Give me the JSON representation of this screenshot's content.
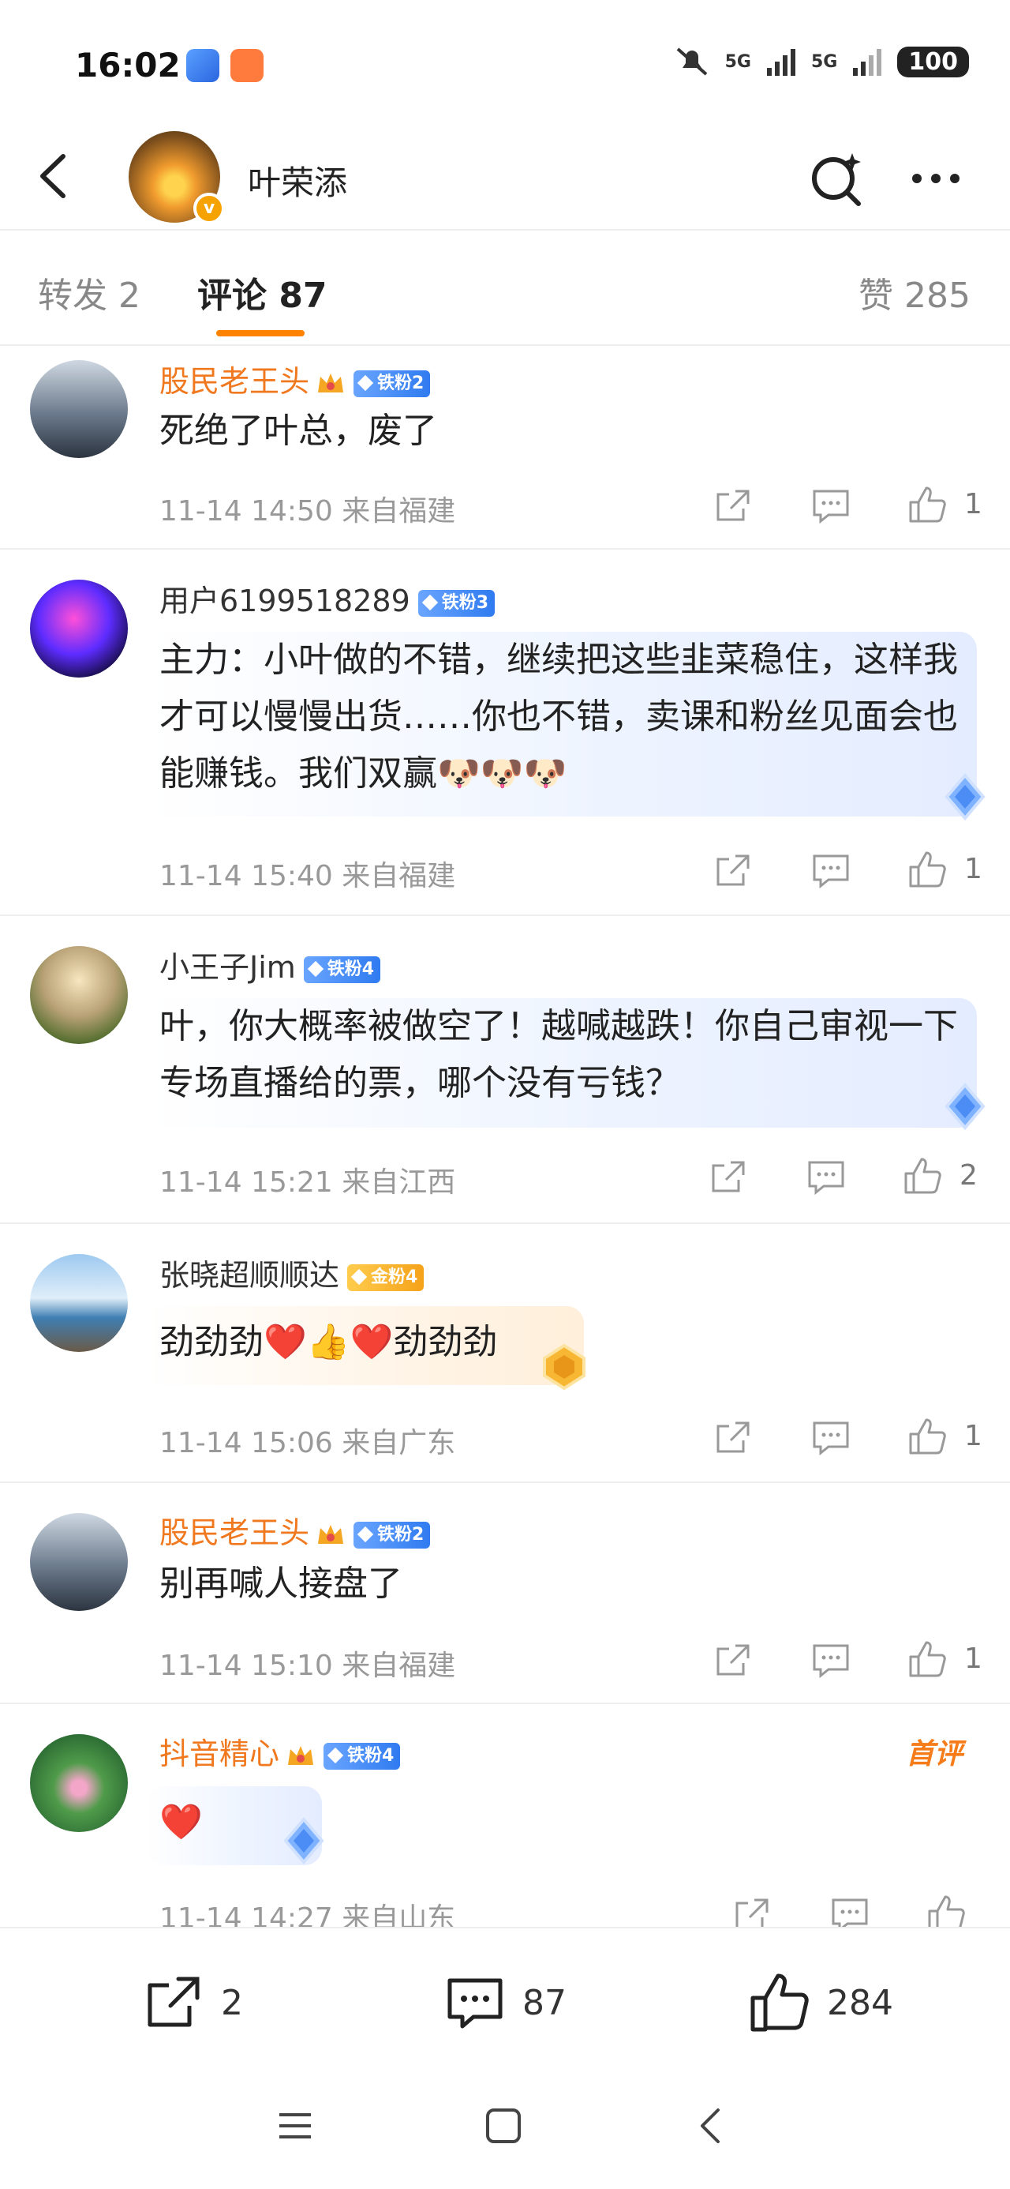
{
  "status_bar": {
    "time": "16:02",
    "net1": "5G",
    "net2": "5G",
    "battery": "100"
  },
  "header": {
    "name": "叶荣添",
    "back_icon": "chevron-left-icon",
    "search_icon": "search-sparkle-icon",
    "more_icon": "more-dots-icon"
  },
  "tabs": {
    "repost": "转发 2",
    "comments": "评论 87",
    "likes": "赞 285"
  },
  "comments": [
    {
      "user": "股民老王头",
      "fan_level": "铁粉2",
      "text": "死绝了叶总，废了",
      "meta": "11-14 14:50  来自福建",
      "likes": "1"
    },
    {
      "user": "用户6199518289",
      "fan_level": "铁粉3",
      "text": "主力：小叶做的不错，继续把这些韭菜稳住，这样我才可以慢慢出货……你也不错，卖课和粉丝见面会也能赚钱。我们双赢🐶🐶🐶",
      "meta": "11-14 15:40  来自福建",
      "likes": "1"
    },
    {
      "user": "小王子Jim",
      "fan_level": "铁粉4",
      "text": "叶，你大概率被做空了！越喊越跌！你自己审视一下专场直播给的票，哪个没有亏钱？",
      "meta": "11-14 15:21  来自江西",
      "likes": "2"
    },
    {
      "user": "张晓超顺顺达",
      "fan_level": "金粉4",
      "text": "劲劲劲❤️👍❤️劲劲劲",
      "meta": "11-14 15:06  来自广东",
      "likes": "1"
    },
    {
      "user": "股民老王头",
      "fan_level": "铁粉2",
      "text": "别再喊人接盘了",
      "meta": "11-14 15:10  来自福建",
      "likes": "1"
    },
    {
      "user": "抖音精心",
      "fan_level": "铁粉4",
      "badge": "首评",
      "text": "❤️",
      "meta": "11-14 14:27  来自山东",
      "likes": ""
    }
  ],
  "bottom_bar": {
    "reposts": "2",
    "comments": "87",
    "likes": "284"
  }
}
